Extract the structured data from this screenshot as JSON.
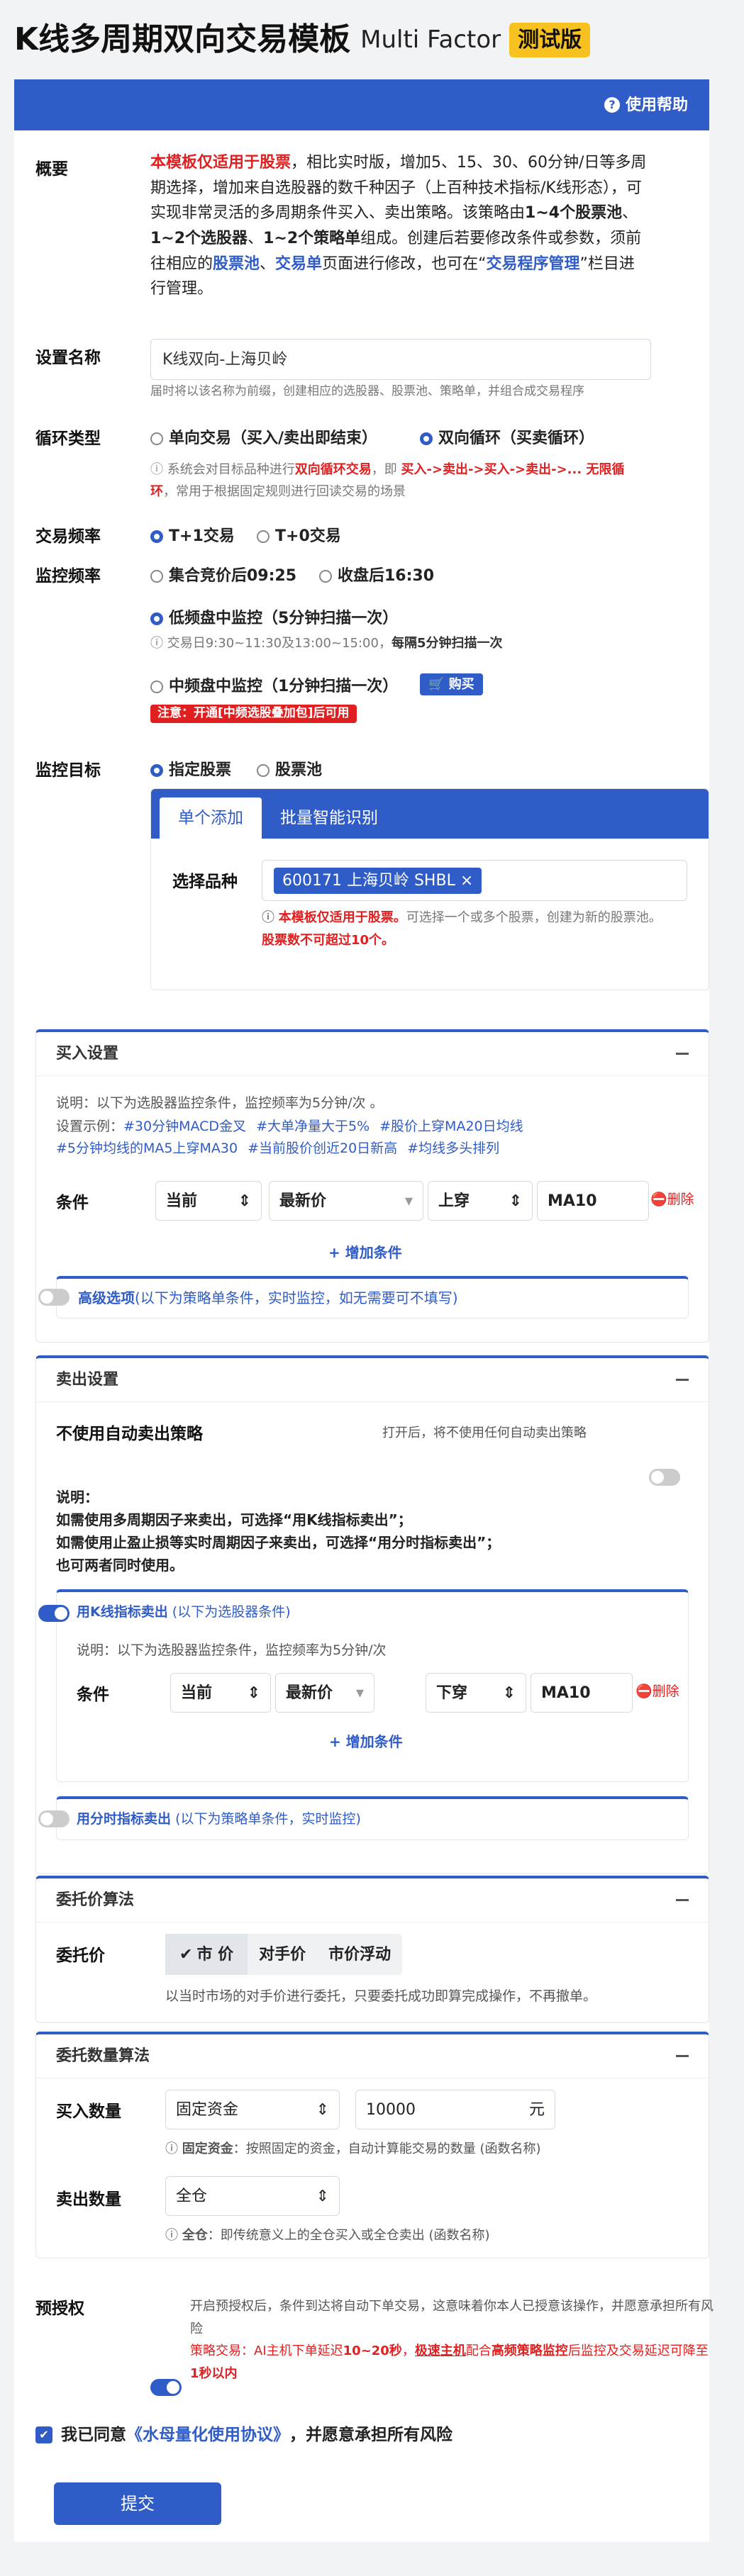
{
  "header": {
    "title": "K线多周期双向交易模板",
    "subtitle": "Multi Factor",
    "badge": "测试版",
    "help": "使用帮助"
  },
  "overview": {
    "label": "概要",
    "p1": "本模板仅适用于股票",
    "p2": "，相比实时版，增加5、15、30、60分钟/日等多周期选择，增加来自选股器的数千种因子（上百种技术指标/K线形态），可实现非常灵活的多周期条件买入、卖出策略。该策略由",
    "p3": "1~4个股票池",
    "p4": "、",
    "p5": "1~2个选股器",
    "p6": "、",
    "p7": "1~2个策略单",
    "p8": "组成。创建后若要修改条件或参数，须前往相应的",
    "p9": "股票池",
    "p10": "、",
    "p11": "交易单",
    "p12": "页面进行修改，也可在“",
    "p13": "交易程序管理",
    "p14": "”栏目进行管理。"
  },
  "name": {
    "label": "设置名称",
    "value": "K线双向-上海贝岭",
    "hint": "届时将以该名称为前缀，创建相应的选股器、股票池、策略单，并组合成交易程序"
  },
  "loop": {
    "label": "循环类型",
    "opt1": "单向交易（买入/卖出即结束）",
    "opt2": "双向循环（买卖循环）",
    "h1": "系统会对目标品种进行",
    "h2": "双向循环交易",
    "h3": "，即 ",
    "h4": "买入->卖出->买入->卖出->... 无限循环",
    "h5": "，常用于根据固定规则进行回读交易的场景"
  },
  "freq": {
    "label": "交易频率",
    "opt1": "T+1交易",
    "opt2": "T+0交易"
  },
  "monitor": {
    "label": "监控频率",
    "opt1": "集合竞价后09:25",
    "opt2": "收盘后16:30",
    "opt3": "低频盘中监控（5分钟扫描一次）",
    "hint3a": "交易日9:30~11:30及13:00~15:00，",
    "hint3b": "每隔5分钟扫描一次",
    "opt4": "中频盘中监控（1分钟扫描一次）",
    "buy": "购买",
    "note4": "注意：开通[中频选股叠加包]后可用"
  },
  "target": {
    "label": "监控目标",
    "opt1": "指定股票",
    "opt2": "股票池",
    "tab1": "单个添加",
    "tab2": "批量智能识别",
    "pick": "选择品种",
    "stock": "600171 上海贝岭 SHBL",
    "w1": "本模板仅适用于股票。",
    "w2": "可选择一个或多个股票，创建为新的股票池。",
    "w3": "股票数不可超过10个。"
  },
  "buy_section": {
    "title": "买入设置",
    "desc": "说明：以下为选股器监控条件，监控频率为5分钟/次 。",
    "example_label": "设置示例：",
    "tags": [
      "#30分钟MACD金叉",
      "#大单净量大于5%",
      "#股价上穿MA20日均线",
      "#5分钟均线的MA5上穿MA30",
      "#当前股价创近20日新高",
      "#均线多头排列"
    ],
    "cond_label": "条件",
    "c1": "当前",
    "c2": "最新价",
    "c3": "上穿",
    "c4": "MA10",
    "del": "删除",
    "add": "增加条件",
    "adv": "高级选项",
    "adv_note": "(以下为策略单条件，实时监控，如无需要可不填写)"
  },
  "sell_section": {
    "title": "卖出设置",
    "noauto": "不使用自动卖出策略",
    "noauto_hint": "打开后，将不使用任何自动卖出策略",
    "d0": "说明：",
    "d1": "如需使用多周期因子来卖出，可选择“用K线指标卖出”；",
    "d2": "如需使用止盈止损等实时周期因子来卖出，可选择“用分时指标卖出”；",
    "d3": "也可两者同时使用。",
    "k_title": "用K线指标卖出",
    "k_note": "(以下为选股器条件)",
    "k_desc": "说明：以下为选股器监控条件，监控频率为5分钟/次",
    "cond_label": "条件",
    "c1": "当前",
    "c2": "最新价",
    "c3": "下穿",
    "c4": "MA10",
    "del": "删除",
    "add": "增加条件",
    "m_title": "用分时指标卖出",
    "m_note": "(以下为策略单条件，实时监控)"
  },
  "price": {
    "title": "委托价算法",
    "label": "委托价",
    "seg1": "市 价",
    "seg2": "对手价",
    "seg3": "市价浮动",
    "hint": "以当时市场的对手价进行委托，只要委托成功即算完成操作，不再撤单。"
  },
  "qty": {
    "title": "委托数量算法",
    "buy_label": "买入数量",
    "buy_mode": "固定资金",
    "buy_value": "10000",
    "unit": "元",
    "buy_h1": "固定资金",
    "buy_h2": "：按照固定的资金，自动计算能交易的数量 (函数名称)",
    "sell_label": "卖出数量",
    "sell_mode": "全仓",
    "sell_h1": "全仓",
    "sell_h2": "：即传统意义上的全仓买入或全仓卖出 (函数名称)"
  },
  "preauth": {
    "label": "预授权",
    "t1": "开启预授权后，条件到达将自动下单交易，这意味着你本人已授意该操作，并愿意承担所有风险",
    "t2": "策略交易：AI主机下单延迟",
    "t3": "10~20秒",
    "t4": "，",
    "t5": "极速主机",
    "t6": "配合",
    "t7": "高频策略监控",
    "t8": "后监控及交易延迟可降至",
    "t9": "1秒以内"
  },
  "agree": {
    "a1": "我已同意",
    "a2": "《水母量化使用协议》",
    "a3": "，并愿意承担所有风险"
  },
  "submit": "提交"
}
